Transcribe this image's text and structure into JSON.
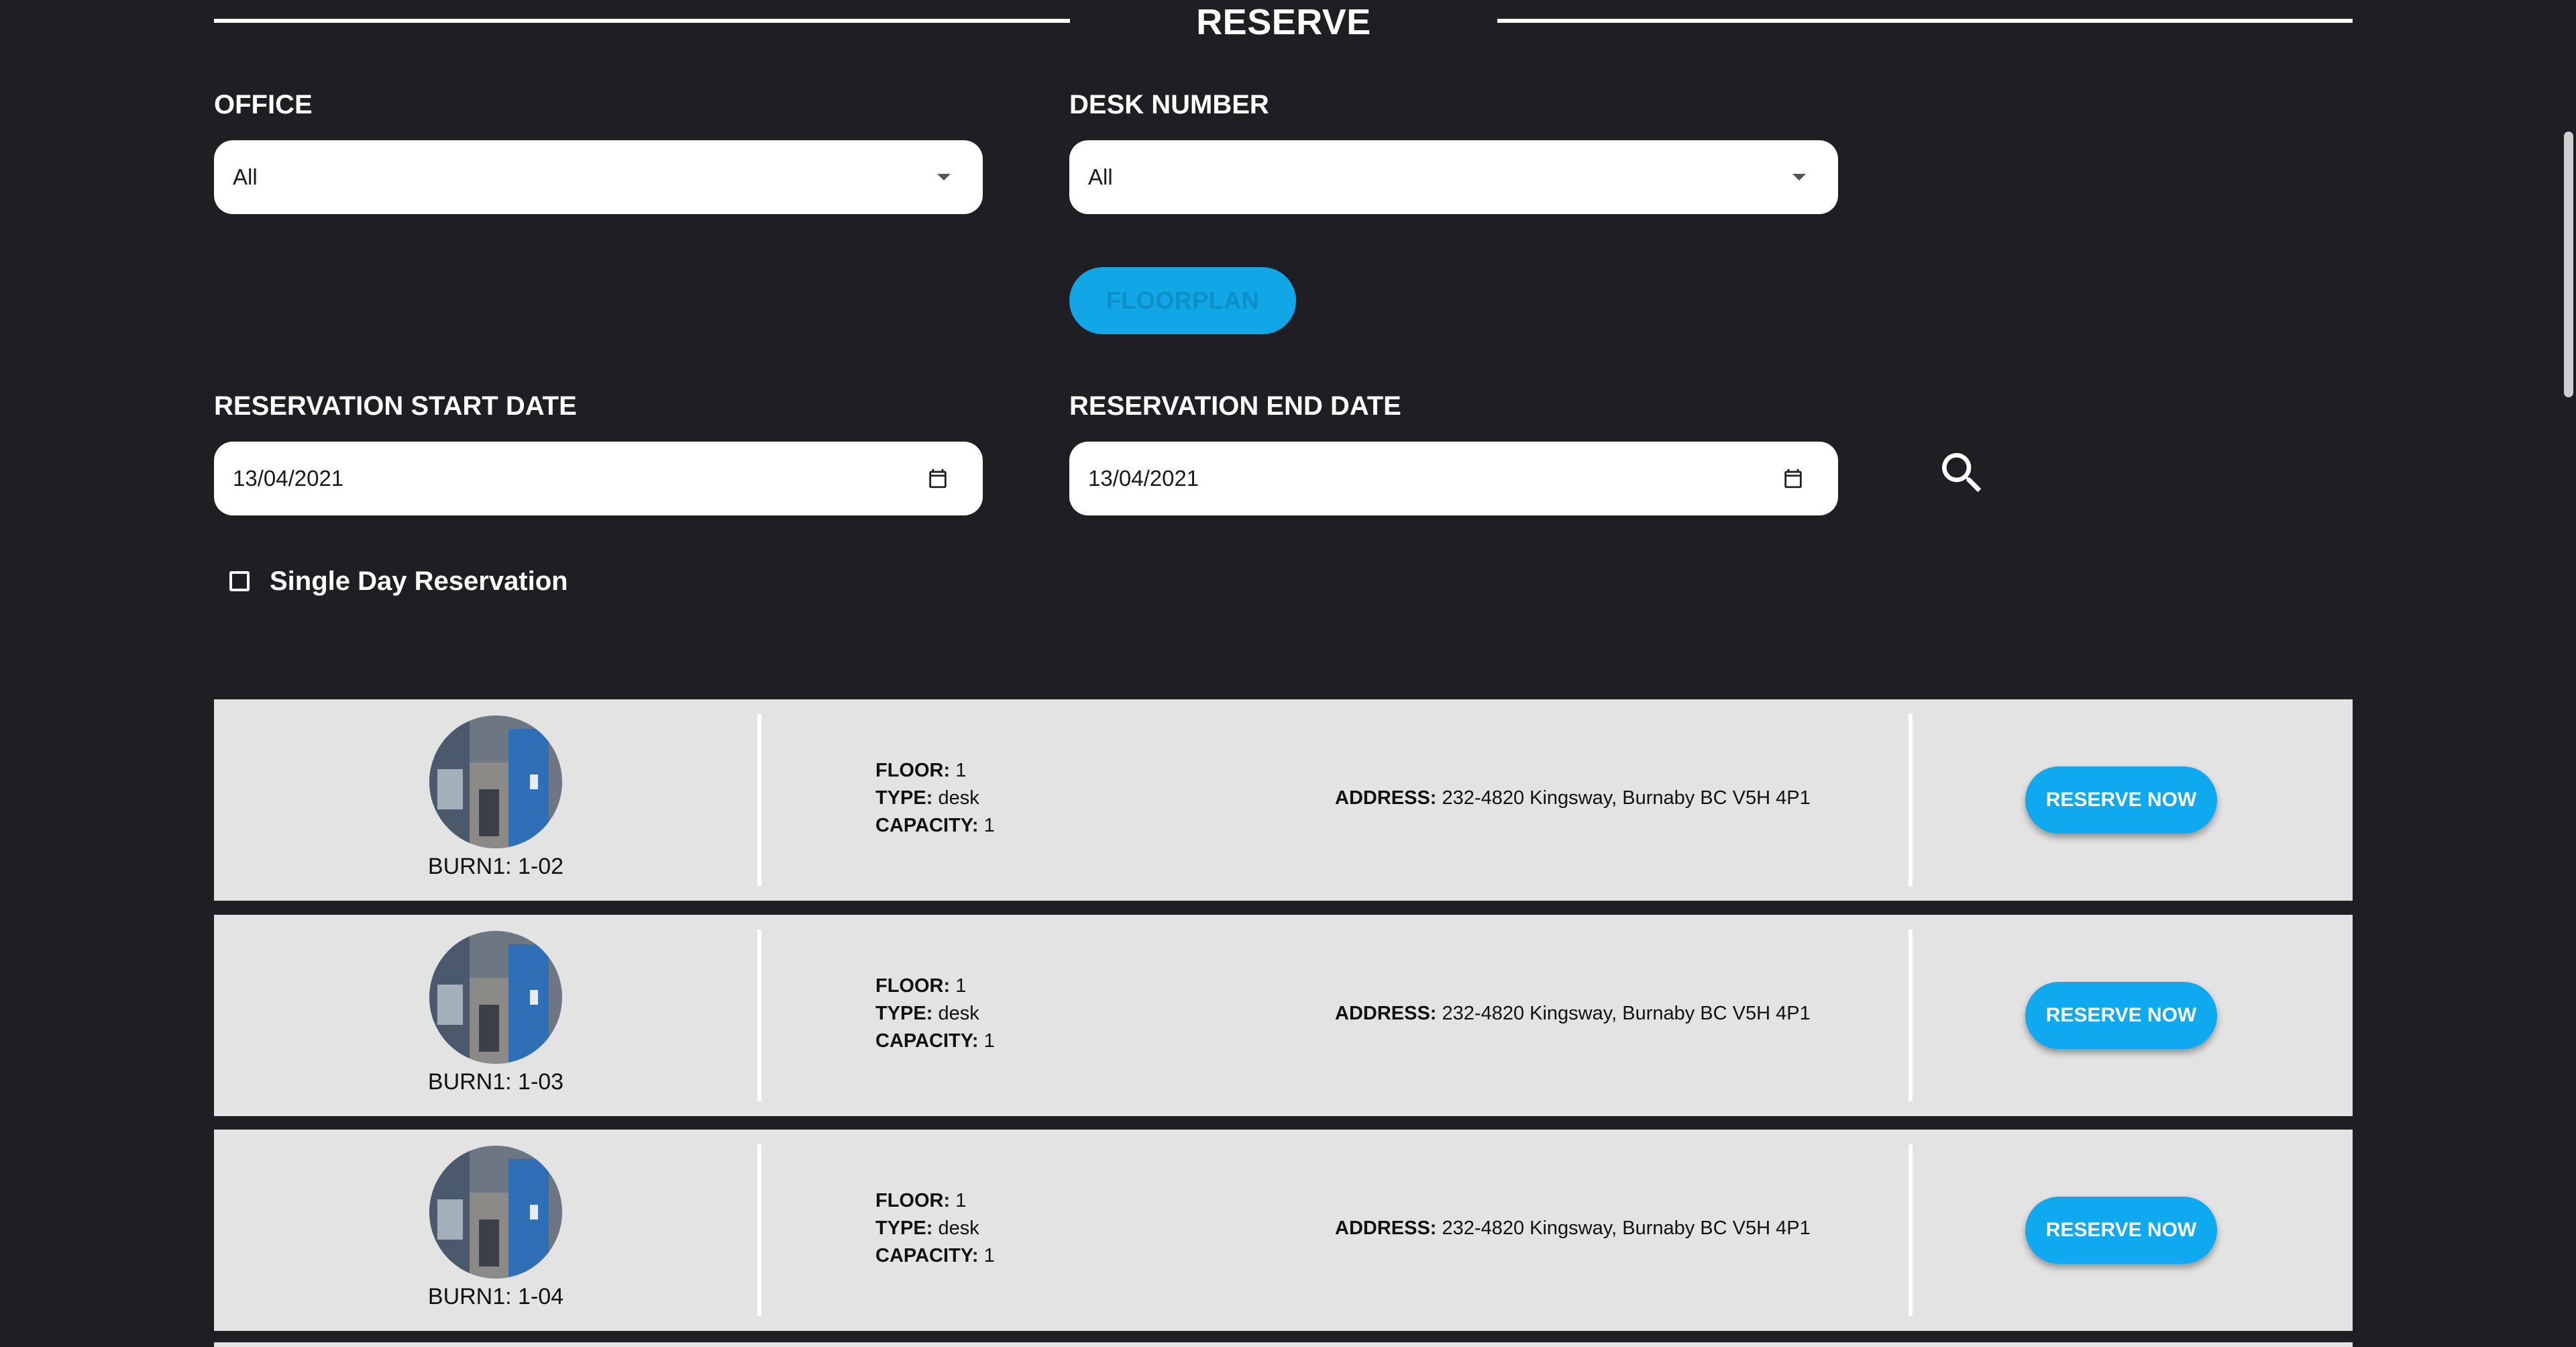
{
  "header": {
    "title": "RESERVE"
  },
  "filters": {
    "office": {
      "label": "OFFICE",
      "value": "All"
    },
    "desk_number": {
      "label": "DESK NUMBER",
      "value": "All"
    },
    "floorplan_label": "FLOORPLAN",
    "start_date": {
      "label": "RESERVATION START DATE",
      "value": "13/04/2021"
    },
    "end_date": {
      "label": "RESERVATION END DATE",
      "value": "13/04/2021"
    },
    "single_day": {
      "label": "Single Day Reservation",
      "checked": false
    }
  },
  "results": [
    {
      "name": "BURN1: 1-02",
      "floor_label": "FLOOR:",
      "floor": "1",
      "type_label": "TYPE:",
      "type": "desk",
      "capacity_label": "CAPACITY:",
      "capacity": "1",
      "address_label": "ADDRESS:",
      "address": "232-4820 Kingsway, Burnaby BC V5H 4P1",
      "action": "RESERVE NOW"
    },
    {
      "name": "BURN1: 1-03",
      "floor_label": "FLOOR:",
      "floor": "1",
      "type_label": "TYPE:",
      "type": "desk",
      "capacity_label": "CAPACITY:",
      "capacity": "1",
      "address_label": "ADDRESS:",
      "address": "232-4820 Kingsway, Burnaby BC V5H 4P1",
      "action": "RESERVE NOW"
    },
    {
      "name": "BURN1: 1-04",
      "floor_label": "FLOOR:",
      "floor": "1",
      "type_label": "TYPE:",
      "type": "desk",
      "capacity_label": "CAPACITY:",
      "capacity": "1",
      "address_label": "ADDRESS:",
      "address": "232-4820 Kingsway, Burnaby BC V5H 4P1",
      "action": "RESERVE NOW"
    }
  ],
  "icons": {
    "office_caret": "chevron-down-icon",
    "desk_caret": "chevron-down-icon",
    "start_calendar": "calendar-icon",
    "end_calendar": "calendar-icon",
    "search": "search-icon",
    "avatar": "office-photo"
  },
  "colors": {
    "background": "#1f1e23",
    "accent": "#0ea9ee",
    "row_background": "#e3e3e3",
    "text_light": "#ffffff"
  }
}
